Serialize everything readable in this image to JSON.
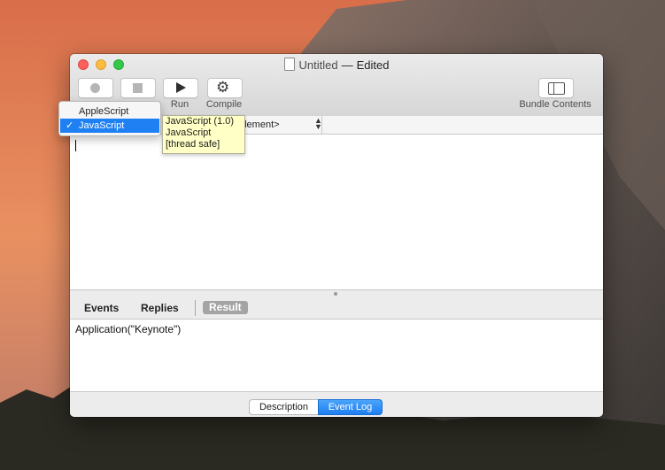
{
  "window": {
    "title": "Untitled",
    "separator": "—",
    "status": "Edited"
  },
  "toolbar": {
    "run_label": "Run",
    "compile_label": "Compile",
    "bundle_label": "Bundle Contents"
  },
  "navbar": {
    "element_text": "element>"
  },
  "language_menu": {
    "items": [
      {
        "label": "AppleScript",
        "checked": false
      },
      {
        "label": "JavaScript",
        "checked": true,
        "check_mark": "✓"
      }
    ]
  },
  "tooltip": {
    "lines": [
      "JavaScript (1.0)",
      "JavaScript",
      "[thread safe]"
    ]
  },
  "log_tabs": {
    "events": "Events",
    "replies": "Replies",
    "result": "Result"
  },
  "result_text": "Application(\"Keynote\")",
  "footer": {
    "description": "Description",
    "event_log": "Event Log"
  },
  "colors": {
    "accent": "#1f80f3",
    "close": "#fc605c",
    "minimize": "#fdbc40",
    "maximize": "#34c84a",
    "tooltip_bg": "#ffffc6"
  }
}
